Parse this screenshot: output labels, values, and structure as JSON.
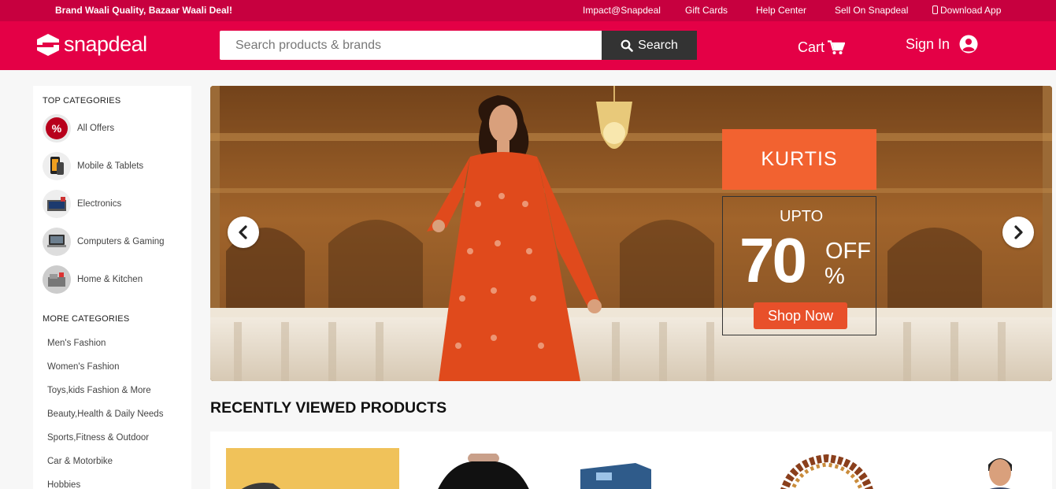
{
  "topbar": {
    "tagline": "Brand Waali Quality, Bazaar Waali Deal!",
    "links": [
      "Impact@Snapdeal",
      "Gift Cards",
      "Help Center",
      "Sell On Snapdeal",
      "Download App"
    ]
  },
  "header": {
    "logo_text": "snapdeal",
    "search_placeholder": "Search products & brands",
    "search_button": "Search",
    "cart_label": "Cart",
    "signin_label": "Sign In"
  },
  "sidebar": {
    "top_heading": "TOP CATEGORIES",
    "top_categories": [
      "All Offers",
      "Mobile & Tablets",
      "Electronics",
      "Computers & Gaming",
      "Home & Kitchen"
    ],
    "more_heading": "MORE CATEGORIES",
    "more_categories": [
      "Men's Fashion",
      "Women's Fashion",
      "Toys,kids Fashion & More",
      "Beauty,Health & Daily Needs",
      "Sports,Fitness & Outdoor",
      "Car & Motorbike",
      "Hobbies"
    ]
  },
  "banner": {
    "headline": "KURTIS",
    "upto": "UPTO",
    "discount": "70",
    "off": "OFF",
    "percent": "%",
    "cta": "Shop Now"
  },
  "recently_viewed": {
    "title": "RECENTLY VIEWED PRODUCTS"
  },
  "colors": {
    "topbar": "#c7003f",
    "header": "#e40046",
    "search_button": "#333333"
  }
}
